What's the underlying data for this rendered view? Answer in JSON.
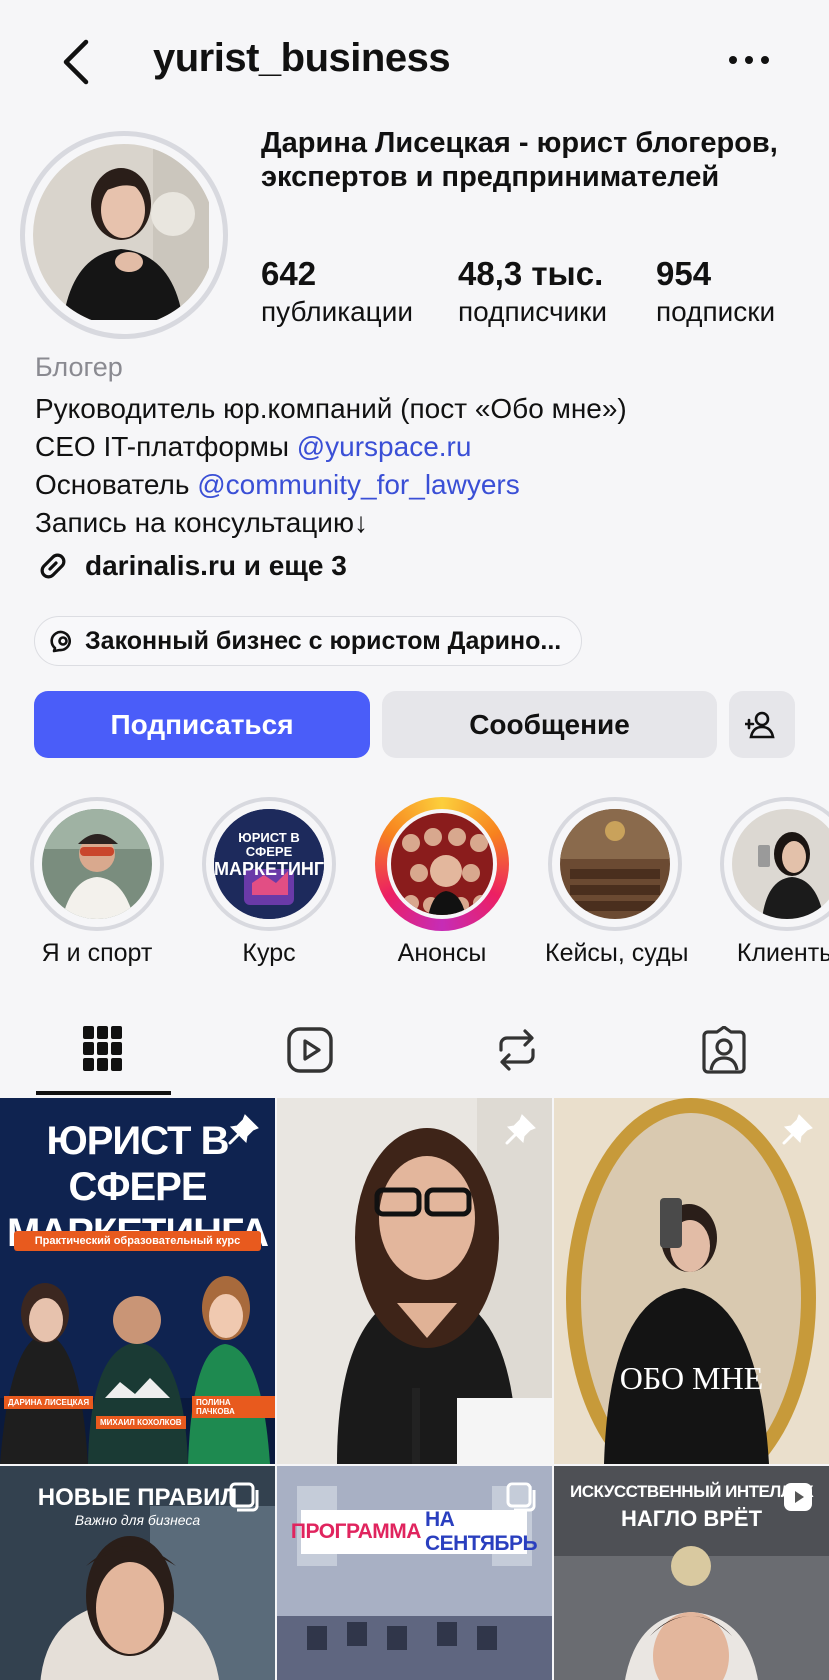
{
  "header": {
    "username": "yurist_business"
  },
  "profile": {
    "full_name": "Дарина Лисецкая - юрист блогеров, экспертов и предпринимателей",
    "stats": [
      {
        "value": "642",
        "label": "публикации"
      },
      {
        "value": "48,3 тыс.",
        "label": "подписчики"
      },
      {
        "value": "954",
        "label": "подписки"
      }
    ],
    "category": "Блогер",
    "bio": {
      "line1": "Руководитель юр.компаний (пост «Обо мне»)",
      "line2_prefix": "CEO IT-платформы ",
      "line2_mention": "@yurspace.ru",
      "line3_prefix": "Основатель ",
      "line3_mention": "@community_for_lawyers",
      "line4": "Запись на консультацию↓"
    },
    "link_text": "darinalis.ru и еще 3",
    "threads_pill": "Законный бизнес с юристом Дарино..."
  },
  "actions": {
    "follow": "Подписаться",
    "message": "Сообщение"
  },
  "highlights": [
    {
      "label": "Я и спорт"
    },
    {
      "label": "Курс",
      "cover_text_1": "ЮРИСТ В СФЕРЕ",
      "cover_text_2": "МАРКЕТИНГА"
    },
    {
      "label": "Анонсы"
    },
    {
      "label": "Кейсы, суды"
    },
    {
      "label": "Клиенты"
    }
  ],
  "posts": {
    "post1": {
      "title1": "ЮРИСТ В СФЕРЕ",
      "title2": "МАРКЕТИНГА",
      "badge": "Практический образовательный курс",
      "name_left": "ДАРИНА ЛИСЕЦКАЯ",
      "name_center": "МИХАИЛ КОХОЛКОВ",
      "name_right": "ПОЛИНА ПАЧКОВА"
    },
    "post3": {
      "caption": "ОБО МНЕ"
    },
    "post4": {
      "title": "НОВЫЕ ПРАВИЛ",
      "subtitle": "Важно для бизнеса"
    },
    "post5": {
      "title_a": "ПРОГРАММА",
      "title_b": "НА СЕНТЯБРЬ"
    },
    "post6": {
      "title1": "ИСКУССТВЕННЫЙ ИНТЕЛЛЕК",
      "title2": "НАГЛО ВРЁТ"
    }
  },
  "colors": {
    "accent": "#4a5df9",
    "mention": "#3a4fd6",
    "secondary_button": "#e6e6ea"
  }
}
